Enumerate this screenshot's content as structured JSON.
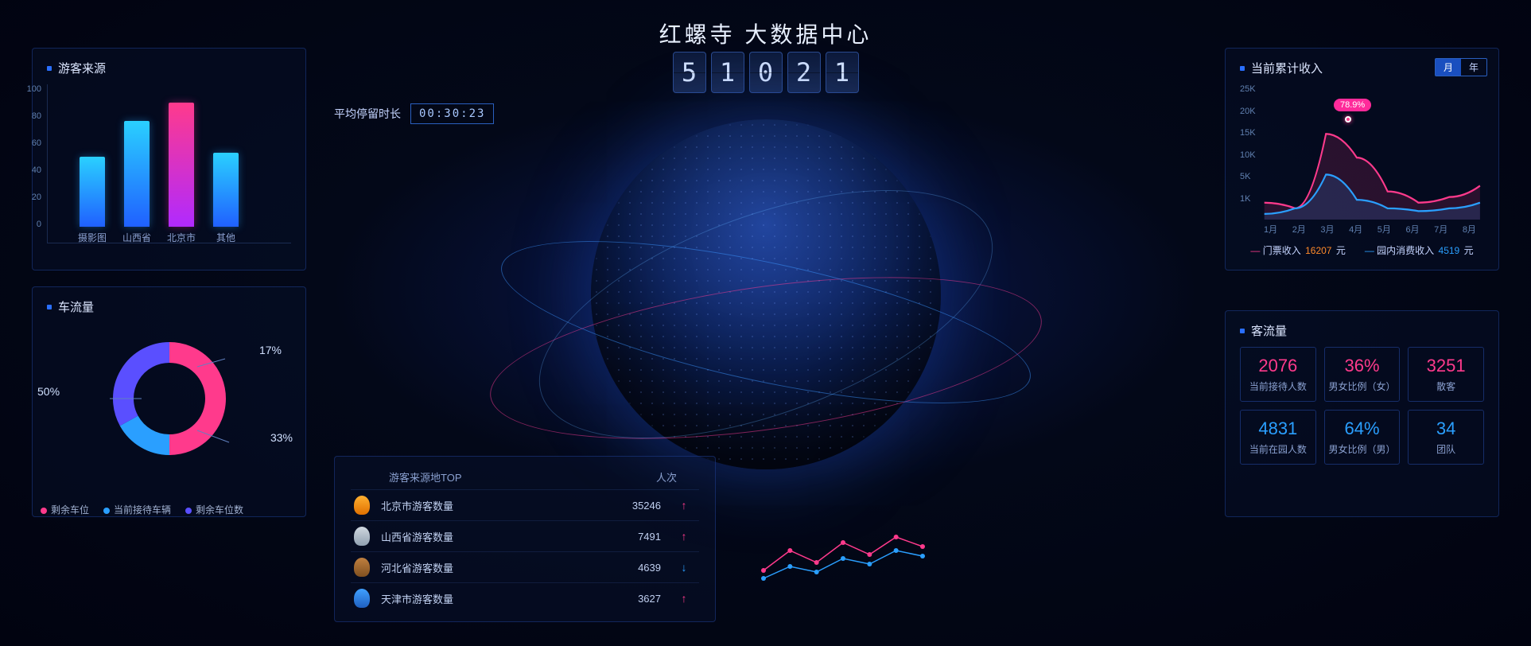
{
  "header": {
    "title": "红螺寺 大数据中心",
    "counter_digits": [
      "5",
      "1",
      "0",
      "2",
      "1"
    ],
    "avg_stay_label": "平均停留时长",
    "avg_stay_value": "00:30:23"
  },
  "panel_source": {
    "title": "游客来源"
  },
  "panel_traffic": {
    "title": "车流量",
    "legend": {
      "remaining_spots": "剩余车位",
      "current_vehicles": "当前接待车辆",
      "remaining_count": "剩余车位数"
    },
    "labels": {
      "p50": "50%",
      "p17": "17%",
      "p33": "33%"
    }
  },
  "panel_income": {
    "title": "当前累计收入",
    "toggle": {
      "month": "月",
      "year": "年"
    },
    "peak_label": "78.9%",
    "legend": {
      "ticket": "门票收入",
      "ticket_val": "16207",
      "inpark": "园内消费收入",
      "inpark_val": "4519",
      "unit": "元"
    }
  },
  "panel_visitors": {
    "title": "客流量",
    "tiles": [
      {
        "value": "2076",
        "label": "当前接待人数",
        "cls": "pink"
      },
      {
        "value": "36%",
        "label": "男女比例（女）",
        "cls": "pink"
      },
      {
        "value": "3251",
        "label": "散客",
        "cls": "pink"
      },
      {
        "value": "4831",
        "label": "当前在园人数",
        "cls": "blue"
      },
      {
        "value": "64%",
        "label": "男女比例（男）",
        "cls": "blue"
      },
      {
        "value": "34",
        "label": "团队",
        "cls": "blue"
      }
    ]
  },
  "top_table": {
    "col1": "游客来源地TOP",
    "col2": "人次",
    "rows": [
      {
        "medal": "m-gold",
        "name": "北京市游客数量",
        "count": "35246",
        "dir": "up"
      },
      {
        "medal": "m-silver",
        "name": "山西省游客数量",
        "count": "7491",
        "dir": "up"
      },
      {
        "medal": "m-bronze",
        "name": "河北省游客数量",
        "count": "4639",
        "dir": "down"
      },
      {
        "medal": "m-blue",
        "name": "天津市游客数量",
        "count": "3627",
        "dir": "up"
      }
    ]
  },
  "chart_data": {
    "visitor_source_bar": {
      "type": "bar",
      "title": "游客来源",
      "categories": [
        "摄影图",
        "山西省",
        "北京市",
        "其他"
      ],
      "values": [
        52,
        78,
        92,
        55
      ],
      "ylim": [
        0,
        100
      ],
      "yticks": [
        0,
        20,
        40,
        60,
        80,
        100
      ],
      "colors": [
        "#2aa8ff",
        "#2aa8ff",
        "#ff2a9a",
        "#2aa8ff"
      ]
    },
    "traffic_donut": {
      "type": "pie",
      "title": "车流量",
      "series": [
        {
          "name": "剩余车位",
          "value": 50,
          "color": "#ff3a8c"
        },
        {
          "name": "当前接待车辆",
          "value": 17,
          "color": "#2a9fff"
        },
        {
          "name": "剩余车位数",
          "value": 33,
          "color": "#5a4fff"
        }
      ]
    },
    "income_line": {
      "type": "line",
      "title": "当前累计收入",
      "x": [
        "1月",
        "2月",
        "3月",
        "4月",
        "5月",
        "6月",
        "7月",
        "8月"
      ],
      "yticks": [
        "1K",
        "5K",
        "10K",
        "15K",
        "20K",
        "25K"
      ],
      "ylim": [
        1000,
        25000
      ],
      "series": [
        {
          "name": "门票收入",
          "color": "#ff3a8c",
          "values": [
            4000,
            3000,
            16207,
            12000,
            6000,
            4000,
            5000,
            7000
          ]
        },
        {
          "name": "园内消费收入",
          "color": "#2a9fff",
          "values": [
            2000,
            3000,
            9000,
            4519,
            3000,
            2500,
            3000,
            4000
          ]
        }
      ],
      "peak": {
        "x_index": 2,
        "pct": "78.9%"
      }
    },
    "sparkline": {
      "type": "line",
      "series": [
        {
          "name": "A",
          "color": "#ff3a8c",
          "values": [
            30,
            55,
            40,
            65,
            50,
            72,
            60
          ]
        },
        {
          "name": "B",
          "color": "#2a9fff",
          "values": [
            20,
            35,
            28,
            45,
            38,
            55,
            48
          ]
        }
      ]
    }
  }
}
